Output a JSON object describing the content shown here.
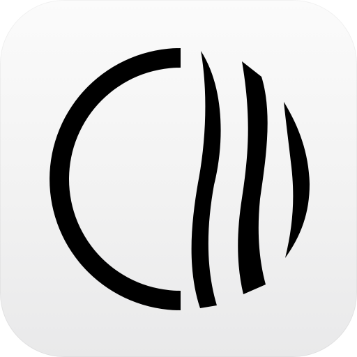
{
  "icon": {
    "name": "app-logo-icon",
    "colors": {
      "background_top": "#fbfbfb",
      "background_bottom": "#e9e9ea",
      "mark": "#000000"
    },
    "parts": [
      "left-arc",
      "wave-stripe-1",
      "wave-stripe-2",
      "right-segment"
    ]
  }
}
